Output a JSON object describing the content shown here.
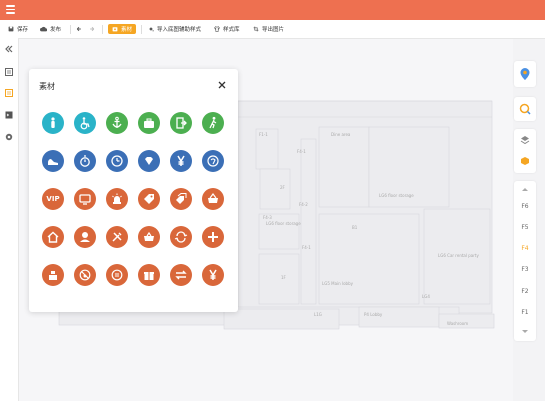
{
  "toolbar": {
    "save": "保存",
    "publish": "发布",
    "material": "素材",
    "import_aux": "导入底图辅助样式",
    "style_lib": "样式库",
    "export_image": "导出图片"
  },
  "colors": {
    "brand": "#ee7050",
    "accent": "#f5a623",
    "icon_teal": "#2ab3c8",
    "icon_green": "#4caf50",
    "icon_blue": "#3b6fb6",
    "icon_orange": "#d9673a"
  },
  "panel": {
    "title": "素材",
    "icons": [
      {
        "name": "person-icon",
        "color": "teal"
      },
      {
        "name": "wheelchair-icon",
        "color": "teal"
      },
      {
        "name": "anchor-icon",
        "color": "green"
      },
      {
        "name": "briefcase-icon",
        "color": "green"
      },
      {
        "name": "exit-icon",
        "color": "green"
      },
      {
        "name": "walking-icon",
        "color": "green"
      },
      {
        "name": "shoe-icon",
        "color": "blue"
      },
      {
        "name": "stopwatch-icon",
        "color": "blue"
      },
      {
        "name": "clock-icon",
        "color": "blue"
      },
      {
        "name": "diamond-icon",
        "color": "blue"
      },
      {
        "name": "yen-icon",
        "color": "blue"
      },
      {
        "name": "phone-24-icon",
        "color": "blue"
      },
      {
        "name": "vip-icon",
        "color": "orange",
        "text": "VIP"
      },
      {
        "name": "tv-icon",
        "color": "orange"
      },
      {
        "name": "alarm-light-icon",
        "color": "orange"
      },
      {
        "name": "price-tag-icon",
        "color": "orange"
      },
      {
        "name": "tags-icon",
        "color": "orange"
      },
      {
        "name": "shopping-basket-icon",
        "color": "orange"
      },
      {
        "name": "home-icon",
        "color": "orange"
      },
      {
        "name": "service-person-icon",
        "color": "orange"
      },
      {
        "name": "tools-icon",
        "color": "orange"
      },
      {
        "name": "basket-icon",
        "color": "orange"
      },
      {
        "name": "exchange-cycle-icon",
        "color": "orange"
      },
      {
        "name": "plus-icon",
        "color": "orange"
      },
      {
        "name": "cashier-icon",
        "color": "orange"
      },
      {
        "name": "no-pet-icon",
        "color": "orange"
      },
      {
        "name": "hour-24-icon",
        "color": "orange"
      },
      {
        "name": "gift-icon",
        "color": "orange"
      },
      {
        "name": "transfer-icon",
        "color": "orange"
      },
      {
        "name": "currency-yen-icon",
        "color": "orange"
      }
    ]
  },
  "floors": [
    "F6",
    "F5",
    "F4",
    "F3",
    "F2",
    "F1"
  ],
  "active_floor": "F4",
  "map_labels": [
    "F1-1",
    "Dine area",
    "F4-1",
    "F4-3",
    "F4-2",
    "F4-1",
    "LG6 floor storage",
    "LG6 floor storage",
    "LG6 Car rental party",
    "LG5 Main lobby",
    "LG4",
    "B1",
    "2F",
    "1F",
    "L1G",
    "P4 Lobby",
    "Washroom"
  ]
}
